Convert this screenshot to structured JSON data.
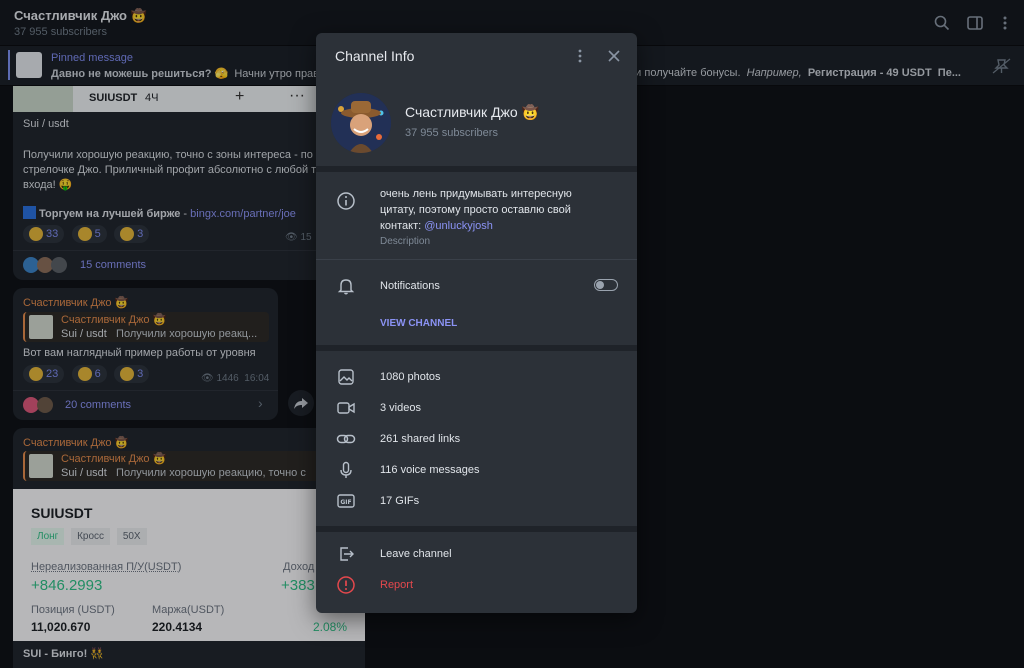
{
  "topbar": {
    "title": "Счастливчик Джо 🤠",
    "subscribers": "37 955 subscribers"
  },
  "pinned": {
    "title": "Pinned message",
    "text_bold": "Давно не можешь решиться? 🫣",
    "text": "Начни утро прав",
    "text_right": "ия и получайте бонусы.",
    "text_italic": "Например,",
    "text_right_bold": "Регистрация - 49 USDT",
    "text_tail": "Пе..."
  },
  "feed": {
    "msg1": {
      "chart_tag": "SUIUSDT",
      "chart_tf": "4Ч",
      "title": "Sui / usdt",
      "body": "Получили хорошую реакцию, точно с зоны интереса - по стрелочке Джо. Приличный профит абсолютно с любой т входа! 🤑",
      "link_prefix": "Торгуем на лучшей бирже",
      "link": "bingx.com/partner/joe",
      "reactions": [
        "33",
        "5",
        "3"
      ],
      "views": "15",
      "comments": "15 comments"
    },
    "msg2": {
      "sender": "Счастливчик Джо 🤠",
      "reply_sender": "Счастливчик Джо 🤠",
      "reply_title": "Sui / usdt",
      "reply_text": "Получили хорошую реакц...",
      "body": "Вот вам наглядный пример работы от уровня",
      "reactions": [
        "23",
        "6",
        "3"
      ],
      "views": "1446",
      "time": "16:04",
      "comments": "20 comments"
    },
    "msg3": {
      "sender": "Счастливчик Джо 🤠",
      "reply_sender": "Счастливчик Джо 🤠",
      "reply_title": "Sui / usdt",
      "reply_text": "Получили хорошую реакцию, точно с",
      "card_title": "SUIUSDT",
      "tag_long": "Лонг",
      "tag_cross": "Кросс",
      "tag_lev": "50X",
      "pnl_label": "Нереализованная П/У(USDT)",
      "pnl_value": "+846.2993",
      "roi_label": "Доход",
      "roi_value": "+383",
      "pos_label": "Позиция (USDT)",
      "pos_value": "11,020.670",
      "margin_label": "Маржа(USDT)",
      "margin_value": "220.4134",
      "ratio_value": "2.08%",
      "caption": "SUI - Бинго! 👯"
    }
  },
  "panel": {
    "header_title": "Channel Info",
    "channel_name": "Счастливчик Джо 🤠",
    "subscribers": "37 955 subscribers",
    "description_line1": "очень лень придумывать интересную",
    "description_line2": "цитату, поэтому просто оставлю свой",
    "description_line3_prefix": "контакт:",
    "description_handle": "@unluckyjosh",
    "description_label": "Description",
    "notifications_label": "Notifications",
    "notifications_on": false,
    "view_channel": "VIEW CHANNEL",
    "media": [
      {
        "icon": "photo-icon",
        "label": "1080 photos"
      },
      {
        "icon": "video-icon",
        "label": "3 videos"
      },
      {
        "icon": "link-icon",
        "label": "261 shared links"
      },
      {
        "icon": "microphone-icon",
        "label": "116 voice messages"
      },
      {
        "icon": "gif-icon",
        "label": "17 GIFs"
      }
    ],
    "leave": "Leave channel",
    "report": "Report"
  },
  "colors": {
    "accent": "#8b93f5",
    "report": "#e5484d",
    "green": "#2ebd85"
  }
}
